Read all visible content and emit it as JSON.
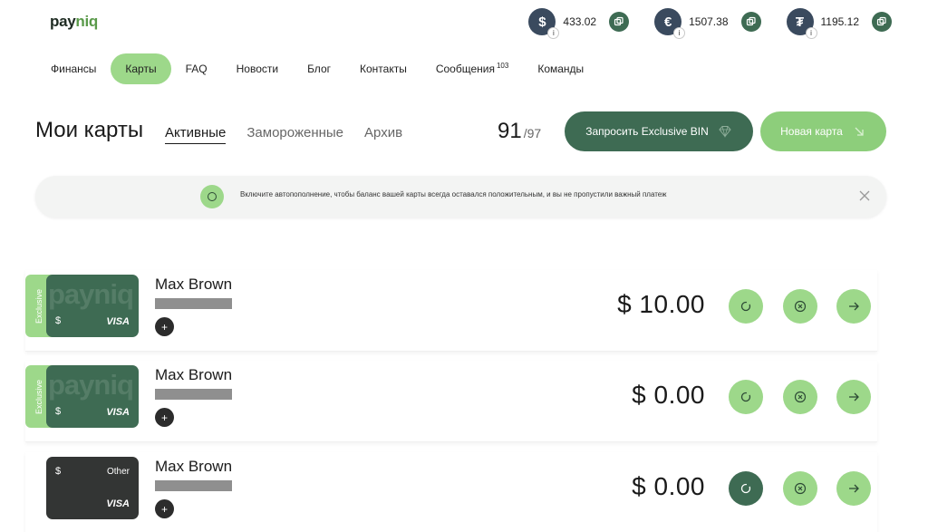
{
  "logo": {
    "part1": "pay",
    "part2": "niq"
  },
  "balances": [
    {
      "symbol": "$",
      "amount": "433.02",
      "info": "i"
    },
    {
      "symbol": "€",
      "amount": "1507.38",
      "info": "i"
    },
    {
      "symbol": "₮",
      "amount": "1195.12",
      "info": "i"
    }
  ],
  "nav": {
    "items": [
      "Финансы",
      "Карты",
      "FAQ",
      "Новости",
      "Блог",
      "Контакты",
      "Сообщения",
      "Команды"
    ],
    "active": "Карты",
    "messages_count": "103"
  },
  "section": {
    "title": "Мои карты",
    "tabs": [
      "Активные",
      "Замороженные",
      "Архив"
    ],
    "active_tab": "Активные",
    "count": "91",
    "total": "/97"
  },
  "buttons": {
    "exclusive_bin": "Запросить Exclusive BIN",
    "new_card": "Новая карта"
  },
  "notice": {
    "text": "Включите автопополнение, чтобы баланс вашей карты всегда оставался положительным, и вы не пропустили важный платеж"
  },
  "cards": [
    {
      "exclusive_label": "Exclusive",
      "watermark": "payniq",
      "currency": "$",
      "network": "VISA",
      "holder": "Max Brown",
      "amount": "$ 10.00",
      "add": "+"
    },
    {
      "exclusive_label": "Exclusive",
      "watermark": "payniq",
      "currency": "$",
      "network": "VISA",
      "holder": "Max Brown",
      "amount": "$ 0.00",
      "add": "+"
    },
    {
      "type_label": "Other",
      "currency": "$",
      "network": "VISA",
      "holder": "Max Brown",
      "amount": "$ 0.00",
      "add": "+"
    }
  ],
  "colors": {
    "primary_dark_green": "#3e6b53",
    "accent_green": "#9dd88a",
    "button_green": "#8dce7b",
    "dark_card": "#333534"
  }
}
